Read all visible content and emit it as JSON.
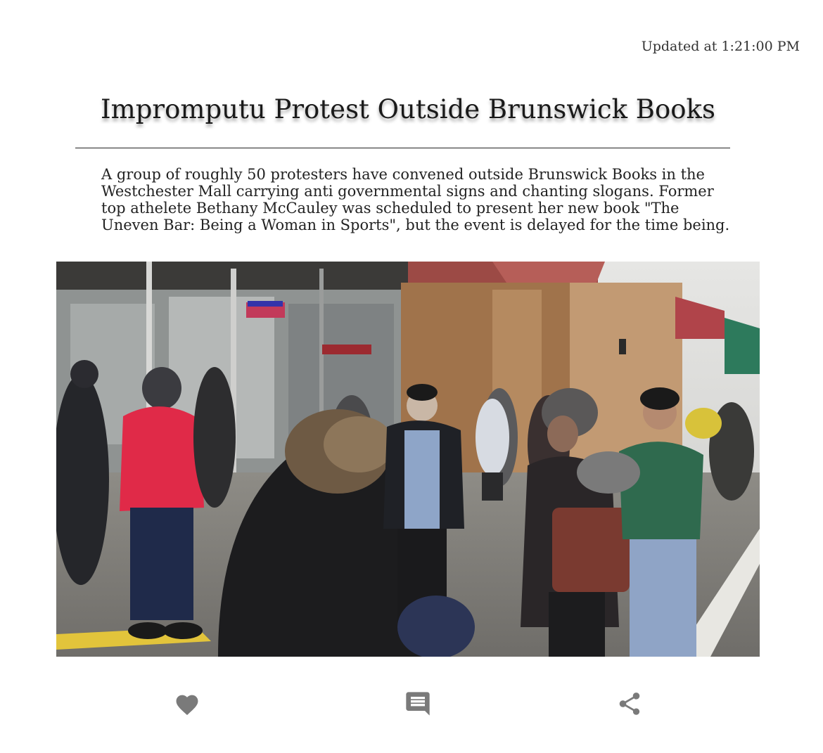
{
  "article": {
    "updated": "Updated at 1:21:00 PM",
    "headline": "Impromputu Protest Outside Brunswick Books",
    "summary": "A group of roughly 50 protesters have convened outside Brunswick Books in the Westchester Mall carrying anti governmental signs and chanting slogans. Former top athelete Bethany McCauley was scheduled to present her new book \"The Uneven Bar: Being a Woman in Sports\", but the event is delayed for the time being."
  },
  "actions": {
    "like_icon": "heart-icon",
    "comment_icon": "comment-icon",
    "share_icon": "share-icon",
    "icon_color": "#7a7a7a"
  }
}
